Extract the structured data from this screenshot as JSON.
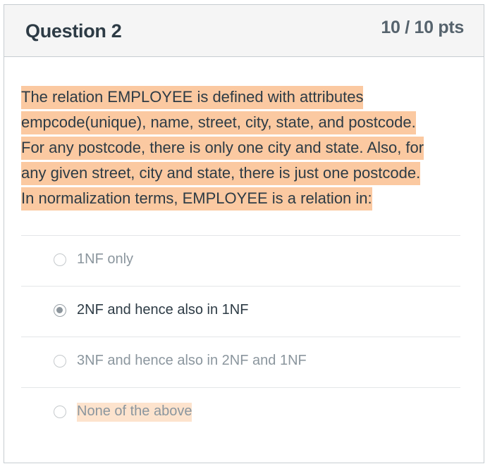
{
  "question": {
    "title": "Question 2",
    "points": "10 / 10 pts",
    "text_lines": [
      "The relation EMPLOYEE is defined with attributes",
      "empcode(unique), name, street, city, state, and postcode.",
      "For any postcode, there is only one city and state. Also, for",
      "any given street, city and state, there is just one postcode.",
      "In normalization terms, EMPLOYEE is a relation in:"
    ],
    "highlight_color": "#fbc9a1"
  },
  "answers": [
    {
      "label": "1NF only",
      "selected": false
    },
    {
      "label": "2NF and hence also in 1NF",
      "selected": true
    },
    {
      "label": "3NF and hence also in 2NF and 1NF",
      "selected": false
    },
    {
      "label": "None of the above",
      "selected": false,
      "highlighted": true
    }
  ],
  "colors": {
    "text": "#2d3b45",
    "muted_text": "#8b969e",
    "header_bg": "#f5f5f5",
    "border": "#c7cdd1"
  }
}
